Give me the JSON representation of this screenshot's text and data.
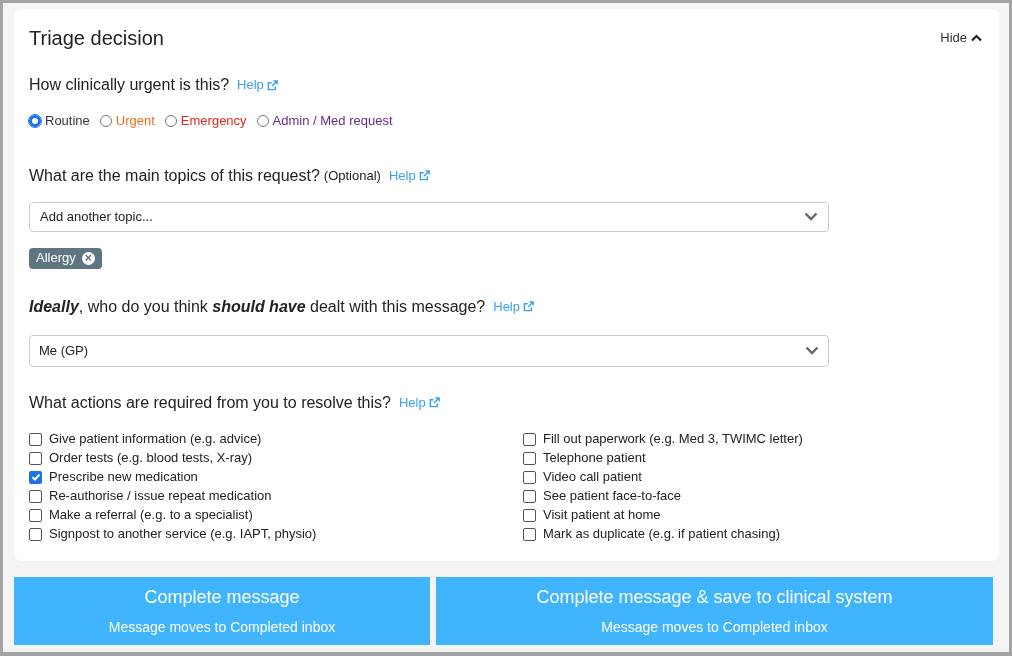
{
  "panel": {
    "title": "Triage decision",
    "toggle": {
      "label": "Hide",
      "expanded": true
    }
  },
  "urgency": {
    "question": "How clinically urgent is this?",
    "help": "Help",
    "options": [
      {
        "label": "Routine",
        "selected": true,
        "color": "#333333"
      },
      {
        "label": "Urgent",
        "selected": false,
        "color": "#e8711a"
      },
      {
        "label": "Emergency",
        "selected": false,
        "color": "#e8261c"
      },
      {
        "label": "Admin / Med request",
        "selected": false,
        "color": "#6b2a8a"
      }
    ]
  },
  "topics": {
    "question": "What are the main topics of this request?",
    "optional": "(Optional)",
    "help": "Help",
    "select": {
      "value": "Add another topic..."
    },
    "tags": [
      {
        "label": "Allergy",
        "remove": "×"
      }
    ]
  },
  "handler": {
    "question": "**Ideally**, who do you think **should have** dealt with this message?",
    "help": "Help",
    "select": {
      "value": "Me (GP)"
    }
  },
  "actions": {
    "question": "What actions are required from you to resolve this?",
    "help": "Help",
    "items": [
      {
        "label": "Give patient information (e.g. advice)",
        "checked": false
      },
      {
        "label": "Order tests (e.g. blood tests, X-ray)",
        "checked": false
      },
      {
        "label": "Prescribe new medication",
        "checked": true
      },
      {
        "label": "Re-authorise / issue repeat medication",
        "checked": false
      },
      {
        "label": "Make a referral (e.g. to a specialist)",
        "checked": false
      },
      {
        "label": "Signpost to another service (e.g. IAPT, physio)",
        "checked": false
      },
      {
        "label": "Fill out paperwork (e.g. Med 3, TWIMC letter)",
        "checked": false
      },
      {
        "label": "Telephone patient",
        "checked": false
      },
      {
        "label": "Video call patient",
        "checked": false
      },
      {
        "label": "See patient face-to-face",
        "checked": false
      },
      {
        "label": "Visit patient at home",
        "checked": false
      },
      {
        "label": "Mark as duplicate (e.g. if patient chasing)",
        "checked": false
      }
    ]
  },
  "buttons": [
    {
      "title": "Complete message",
      "subtitle": "Message moves to Completed inbox"
    },
    {
      "title": "Complete message & save to clinical system",
      "subtitle": "Message moves to Completed inbox"
    }
  ]
}
